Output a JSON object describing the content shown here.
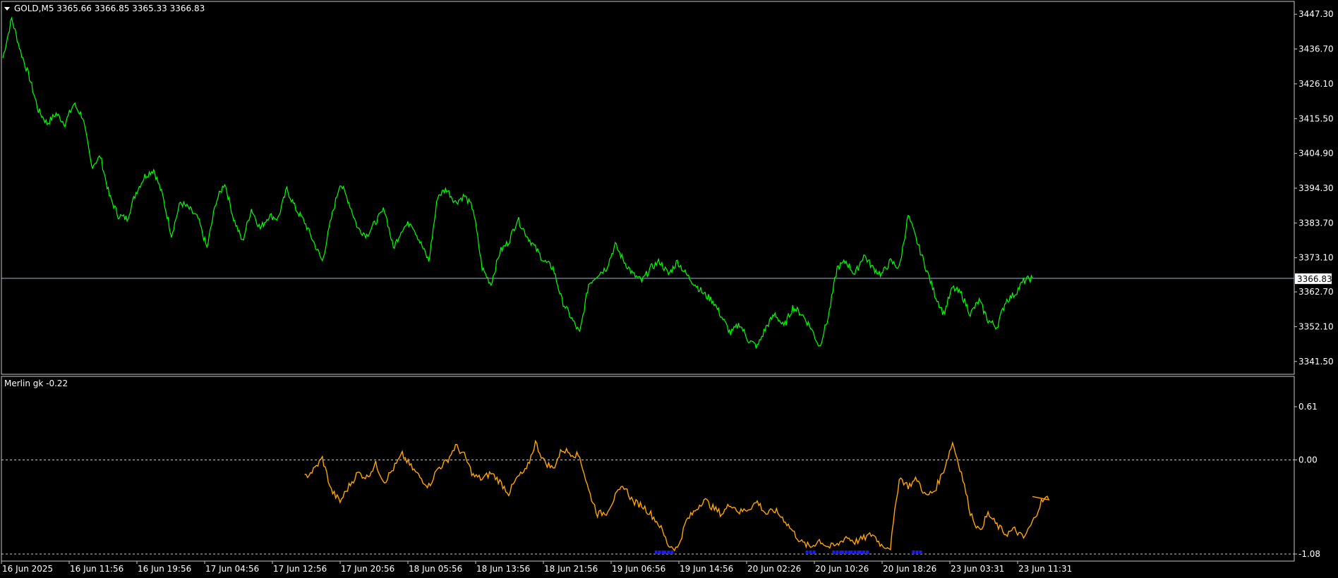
{
  "colors": {
    "background": "#000000",
    "frame": "#c8c8c8",
    "price_line": "#00ff00",
    "current_price_line": "#9fb6c6",
    "indicator_line": "#ffa500",
    "indicator_marker": "#1a1aff",
    "text": "#ffffff",
    "badge_bg": "#ffffff"
  },
  "main_panel": {
    "menu_icon": "triangle-down-icon",
    "header": "GOLD,M5  3365.66 3366.85 3365.33 3366.83",
    "current_price_label": "3366.83"
  },
  "sub_panel": {
    "header": "Merlin gk -0.22"
  },
  "chart_data": [
    {
      "type": "line",
      "title": "GOLD,M5",
      "series": [
        {
          "name": "GOLD",
          "values": [
            3434,
            3446,
            3436,
            3428,
            3418,
            3414,
            3417,
            3414,
            3420,
            3416,
            3401,
            3404,
            3392,
            3386,
            3385,
            3393,
            3398,
            3400,
            3392,
            3380,
            3390,
            3388,
            3385,
            3376,
            3390,
            3396,
            3385,
            3378,
            3388,
            3382,
            3386,
            3385,
            3394,
            3388,
            3384,
            3378,
            3372,
            3385,
            3396,
            3390,
            3382,
            3380,
            3384,
            3388,
            3376,
            3382,
            3384,
            3378,
            3372,
            3392,
            3394,
            3390,
            3392,
            3388,
            3370,
            3365,
            3375,
            3378,
            3385,
            3380,
            3376,
            3372,
            3370,
            3360,
            3355,
            3350,
            3365,
            3368,
            3370,
            3377,
            3372,
            3368,
            3366,
            3370,
            3372,
            3368,
            3372,
            3368,
            3365,
            3362,
            3360,
            3355,
            3350,
            3353,
            3348,
            3346,
            3352,
            3356,
            3352,
            3358,
            3356,
            3352,
            3346,
            3355,
            3370,
            3372,
            3368,
            3374,
            3370,
            3368,
            3372,
            3370,
            3386,
            3378,
            3370,
            3362,
            3356,
            3364,
            3362,
            3356,
            3360,
            3354,
            3352,
            3360,
            3362,
            3366,
            3367
          ]
        }
      ],
      "y_ticks": [
        "3447.30",
        "3436.70",
        "3426.10",
        "3415.50",
        "3404.90",
        "3394.30",
        "3383.70",
        "3373.10",
        "3362.70",
        "3352.10",
        "3341.50"
      ],
      "ylim": [
        3337.8,
        3451.0
      ],
      "current_price": 3366.83
    },
    {
      "type": "line",
      "title": "Merlin gk -0.22",
      "series": [
        {
          "name": "Merlin gk",
          "values": [
            null,
            null,
            null,
            null,
            null,
            null,
            null,
            null,
            null,
            null,
            null,
            null,
            null,
            null,
            null,
            null,
            null,
            null,
            null,
            null,
            null,
            null,
            null,
            null,
            null,
            null,
            null,
            null,
            null,
            null,
            null,
            null,
            null,
            null,
            -0.2,
            -0.12,
            0.02,
            -0.35,
            -0.48,
            -0.3,
            -0.15,
            -0.2,
            -0.05,
            -0.25,
            -0.1,
            0.06,
            -0.08,
            -0.2,
            -0.3,
            -0.1,
            -0.02,
            0.16,
            0.05,
            -0.18,
            -0.22,
            -0.15,
            -0.25,
            -0.38,
            -0.2,
            -0.12,
            0.2,
            -0.02,
            -0.1,
            0.12,
            0.08,
            0.04,
            -0.35,
            -0.62,
            -0.6,
            -0.42,
            -0.3,
            -0.48,
            -0.52,
            -0.62,
            -0.75,
            -0.98,
            -1.02,
            -0.7,
            -0.58,
            -0.45,
            -0.55,
            -0.62,
            -0.5,
            -0.6,
            -0.56,
            -0.48,
            -0.62,
            -0.58,
            -0.68,
            -0.82,
            -0.95,
            -1.0,
            -0.92,
            -1.0,
            -0.98,
            -0.88,
            -0.94,
            -0.9,
            -0.85,
            -0.98,
            -1.0,
            -0.2,
            -0.3,
            -0.22,
            -0.42,
            -0.35,
            -0.12,
            0.2,
            -0.15,
            -0.6,
            -0.82,
            -0.62,
            -0.75,
            -0.85,
            -0.8,
            -0.9,
            -0.72,
            -0.48,
            -0.42
          ]
        }
      ],
      "markers": [
        74,
        75,
        91,
        94,
        95,
        96,
        97,
        103
      ],
      "y_ticks": [
        "0.61",
        "0.00",
        "-1.08"
      ],
      "ylim": [
        -1.08,
        0.61
      ],
      "reference_levels": [
        0.0,
        -1.08
      ]
    }
  ],
  "x_axis": {
    "labels": [
      "16 Jun 2025",
      "16 Jun 11:56",
      "16 Jun 19:56",
      "17 Jun 04:56",
      "17 Jun 12:56",
      "17 Jun 20:56",
      "18 Jun 05:56",
      "18 Jun 13:56",
      "18 Jun 21:56",
      "19 Jun 06:56",
      "19 Jun 14:56",
      "20 Jun 02:26",
      "20 Jun 10:26",
      "20 Jun 18:26",
      "23 Jun 03:31",
      "23 Jun 11:31"
    ]
  }
}
